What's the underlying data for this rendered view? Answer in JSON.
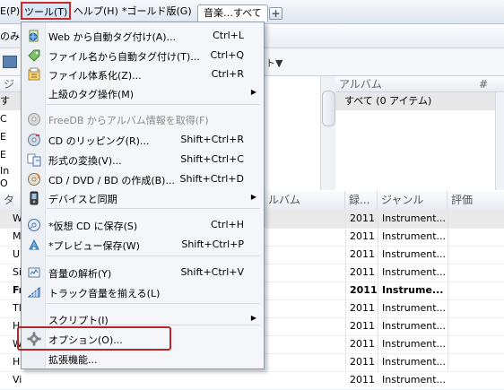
{
  "menubar": {
    "items": [
      {
        "label": "E(P)"
      },
      {
        "label": "ツール(T)"
      },
      {
        "label": "ヘルプ(H)"
      },
      {
        "label": "*ゴールド版(G)"
      }
    ],
    "tab_label": "音楽…すべて",
    "add_tab": "+"
  },
  "toolbar": {
    "filter_text": "のみ",
    "dropdown_label": "ト▼"
  },
  "browser": {
    "left_header": "ジ",
    "left_rows": [
      "す",
      "C",
      "E",
      "E",
      "In",
      "O"
    ],
    "album_header": "アルバム",
    "album_rows": [
      "すべて (0 アイテム)"
    ],
    "right_header": "#"
  },
  "tracks": {
    "columns": {
      "title": "タ",
      "album": "ルバム",
      "year": "録...",
      "genre": "ジャンル",
      "rating": "評価"
    },
    "rows": [
      {
        "edge": "W",
        "year": "2011",
        "genre": "Instrument...",
        "bold": false,
        "selected": true
      },
      {
        "edge": "M",
        "year": "2011",
        "genre": "Instrument...",
        "bold": false,
        "selected": false
      },
      {
        "edge": "U",
        "year": "2011",
        "genre": "Instrument...",
        "bold": false,
        "selected": false
      },
      {
        "edge": "Si",
        "year": "2011",
        "genre": "Instrument...",
        "bold": false,
        "selected": false
      },
      {
        "edge": "Fr",
        "year": "2011",
        "genre": "Instrume...",
        "bold": true,
        "selected": false
      },
      {
        "edge": "Tl",
        "year": "2011",
        "genre": "Instrument...",
        "bold": false,
        "selected": false
      },
      {
        "edge": "H",
        "year": "2011",
        "genre": "Instrument...",
        "bold": false,
        "selected": false
      },
      {
        "edge": "W",
        "year": "2011",
        "genre": "Instrument...",
        "bold": false,
        "selected": false
      },
      {
        "edge": "H",
        "year": "2011",
        "genre": "Instrument...",
        "bold": false,
        "selected": false
      },
      {
        "edge": "Vi",
        "year": "2011",
        "genre": "Instrument...",
        "bold": false,
        "selected": false
      }
    ]
  },
  "menu": {
    "items": [
      {
        "label": "Web から自動タグ付け(A)...",
        "shortcut": "Ctrl+L",
        "icon": "web-tag-icon",
        "submenu": false,
        "disabled": false
      },
      {
        "label": "ファイル名から自動タグ付け(T)...",
        "shortcut": "Ctrl+Q",
        "icon": "filename-tag-icon",
        "submenu": false,
        "disabled": false
      },
      {
        "label": "ファイル体系化(Z)...",
        "shortcut": "Ctrl+R",
        "icon": "organize-files-icon",
        "submenu": false,
        "disabled": false
      },
      {
        "label": "上級のタグ操作(M)",
        "shortcut": "",
        "icon": "",
        "submenu": true,
        "disabled": false
      },
      {
        "label": "FreeDB からアルバム情報を取得(F)",
        "shortcut": "",
        "icon": "freedb-disc-icon",
        "submenu": false,
        "disabled": true
      },
      {
        "label": "CD のリッピング(R)...",
        "shortcut": "Shift+Ctrl+R",
        "icon": "rip-cd-icon",
        "submenu": false,
        "disabled": false
      },
      {
        "label": "形式の変換(V)...",
        "shortcut": "Shift+Ctrl+C",
        "icon": "convert-format-icon",
        "submenu": false,
        "disabled": false
      },
      {
        "label": "CD / DVD / BD の作成(B)...",
        "shortcut": "Shift+Ctrl+D",
        "icon": "burn-disc-icon",
        "submenu": false,
        "disabled": false
      },
      {
        "label": "デバイスと同期",
        "shortcut": "",
        "icon": "device-sync-icon",
        "submenu": true,
        "disabled": false
      },
      {
        "label": "*仮想 CD に保存(S)",
        "shortcut": "Ctrl+H",
        "icon": "virtual-cd-icon",
        "submenu": false,
        "disabled": false
      },
      {
        "label": "*プレビュー保存(W)",
        "shortcut": "Shift+Ctrl+P",
        "icon": "preview-save-icon",
        "submenu": false,
        "disabled": false
      },
      {
        "label": "音量の解析(Y)",
        "shortcut": "Shift+Ctrl+V",
        "icon": "volume-analyze-icon",
        "submenu": false,
        "disabled": false
      },
      {
        "label": "トラック音量を揃える(L)",
        "shortcut": "",
        "icon": "level-volume-icon",
        "submenu": false,
        "disabled": false
      },
      {
        "label": "スクリプト(I)",
        "shortcut": "",
        "icon": "",
        "submenu": true,
        "disabled": false
      },
      {
        "label": "オプション(O)...",
        "shortcut": "",
        "icon": "gear-icon",
        "submenu": false,
        "disabled": false
      },
      {
        "label": "拡張機能...",
        "shortcut": "",
        "icon": "",
        "submenu": false,
        "disabled": false
      }
    ],
    "highlight_color": "#b5262a"
  }
}
